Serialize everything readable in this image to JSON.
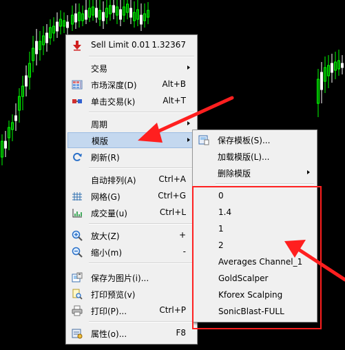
{
  "main_menu": {
    "items": [
      {
        "label": "Sell Limit 0.01",
        "shortcut": "1.32367",
        "icon": "sell-limit-icon"
      },
      {
        "label": "交易",
        "has_submenu": true
      },
      {
        "label": "市场深度(D)",
        "shortcut": "Alt+B",
        "icon": "market-depth-icon"
      },
      {
        "label": "单击交易(k)",
        "shortcut": "Alt+T",
        "icon": "one-click-trading-icon"
      },
      {
        "label": "周期",
        "has_submenu": true
      },
      {
        "label": "模版",
        "has_submenu": true,
        "highlighted": true
      },
      {
        "label": "刷新(R)",
        "icon": "refresh-icon"
      },
      {
        "label": "自动排列(A)",
        "shortcut": "Ctrl+A"
      },
      {
        "label": "网格(G)",
        "shortcut": "Ctrl+G",
        "icon": "grid-icon"
      },
      {
        "label": "成交量(u)",
        "shortcut": "Ctrl+L",
        "icon": "volume-icon"
      },
      {
        "label": "放大(Z)",
        "shortcut": "+",
        "icon": "zoom-in-icon"
      },
      {
        "label": "缩小(m)",
        "shortcut": "-",
        "icon": "zoom-out-icon"
      },
      {
        "label": "保存为图片(i)...",
        "icon": "save-picture-icon"
      },
      {
        "label": "打印预览(v)",
        "icon": "print-preview-icon"
      },
      {
        "label": "打印(P)...",
        "shortcut": "Ctrl+P",
        "icon": "print-icon"
      },
      {
        "label": "属性(o)...",
        "shortcut": "F8",
        "icon": "properties-icon"
      }
    ]
  },
  "template_submenu": {
    "items": [
      {
        "label": "保存模板(S)...",
        "icon": "save-template-icon"
      },
      {
        "label": "加载模版(L)..."
      },
      {
        "label": "删除模版",
        "has_submenu": true
      }
    ],
    "templates": [
      "0",
      "1.4",
      "1",
      "2",
      "Averages Channel_1",
      "GoldScalper",
      "Kforex Scalping",
      "SonicBlast-FULL"
    ]
  },
  "colors": {
    "chart_background": "#000000",
    "bull_candle": "#00ff00",
    "bear_candle": "#ffffff",
    "annotation": "#ff1f1f",
    "menu_highlight": "#c4d8ef"
  }
}
